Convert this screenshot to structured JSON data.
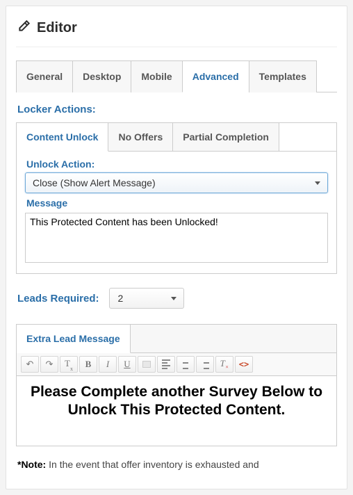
{
  "header": {
    "title": "Editor"
  },
  "tabs": {
    "general": "General",
    "desktop": "Desktop",
    "mobile": "Mobile",
    "advanced": "Advanced",
    "templates": "Templates"
  },
  "locker": {
    "section_label": "Locker Actions:",
    "subtabs": {
      "content_unlock": "Content Unlock",
      "no_offers": "No Offers",
      "partial_completion": "Partial Completion"
    },
    "unlock_action_label": "Unlock Action:",
    "unlock_action_value": "Close (Show Alert Message)",
    "message_label": "Message",
    "message_value": "This Protected Content has been Unlocked!"
  },
  "leads": {
    "label": "Leads Required:",
    "value": "2"
  },
  "extra": {
    "tab_label": "Extra Lead Message",
    "toolbar": {
      "undo": "↶",
      "redo": "↷",
      "clearfmt": "T",
      "clearfmt_sub": "x",
      "bold": "B",
      "italic": "I",
      "underline": "U",
      "src": "<>"
    },
    "content": "Please Complete another Survey Below to Unlock This Protected Content."
  },
  "note": {
    "prefix": "*Note:",
    "text": " In the event that offer inventory is exhausted and"
  }
}
